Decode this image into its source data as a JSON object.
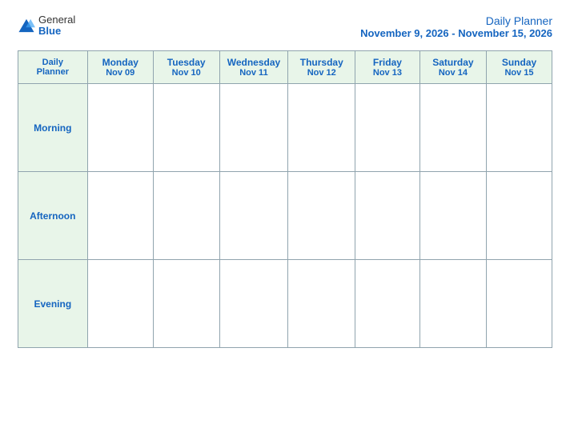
{
  "logo": {
    "general": "General",
    "blue": "Blue"
  },
  "title": {
    "main": "Daily Planner",
    "date_range": "November 9, 2026 - November 15, 2026"
  },
  "header_row": {
    "first_col_line1": "Daily",
    "first_col_line2": "Planner",
    "days": [
      {
        "name": "Monday",
        "date": "Nov 09"
      },
      {
        "name": "Tuesday",
        "date": "Nov 10"
      },
      {
        "name": "Wednesday",
        "date": "Nov 11"
      },
      {
        "name": "Thursday",
        "date": "Nov 12"
      },
      {
        "name": "Friday",
        "date": "Nov 13"
      },
      {
        "name": "Saturday",
        "date": "Nov 14"
      },
      {
        "name": "Sunday",
        "date": "Nov 15"
      }
    ]
  },
  "rows": [
    {
      "label": "Morning"
    },
    {
      "label": "Afternoon"
    },
    {
      "label": "Evening"
    }
  ]
}
